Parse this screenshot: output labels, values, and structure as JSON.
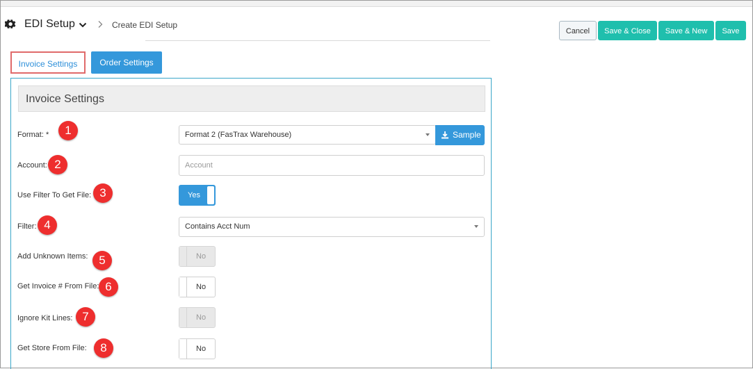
{
  "header": {
    "app_title": "EDI Setup",
    "breadcrumb": "Create EDI Setup",
    "icons": {
      "settings": "gear-icon",
      "dropdown": "chevron-down-icon",
      "separator": "chevron-right-icon"
    }
  },
  "toolbar": {
    "cancel_label": "Cancel",
    "save_close_label": "Save & Close",
    "save_new_label": "Save & New",
    "save_label": "Save",
    "accent_color": "#1fbfad"
  },
  "tabs": [
    {
      "label": "Invoice Settings",
      "active": true
    },
    {
      "label": "Order Settings",
      "active": false
    }
  ],
  "panel": {
    "title": "Invoice Settings",
    "fields": {
      "format": {
        "label": "Format: *",
        "badge": "1",
        "value": "Format 2 (FasTrax Warehouse)",
        "sample_label": "Sample"
      },
      "account": {
        "label": "Account:",
        "badge": "2",
        "value": "",
        "placeholder": "Account"
      },
      "use_filter": {
        "label": "Use Filter To Get File:",
        "badge": "3",
        "value": "Yes"
      },
      "filter": {
        "label": "Filter:",
        "badge": "4",
        "value": "Contains Acct Num"
      },
      "add_unknown_items": {
        "label": "Add Unknown Items:",
        "badge": "5",
        "value": "No"
      },
      "get_invoice_from_file": {
        "label": "Get Invoice # From File:",
        "badge": "6",
        "value": "No"
      },
      "ignore_kit_lines": {
        "label": "Ignore Kit Lines:",
        "badge": "7",
        "value": "No"
      },
      "get_store_from_file": {
        "label": "Get Store From File:",
        "badge": "8",
        "value": "No"
      }
    }
  },
  "colors": {
    "primary": "#3498db",
    "badge": "#ee2e2e",
    "tab_highlight": "#e06a6a"
  }
}
